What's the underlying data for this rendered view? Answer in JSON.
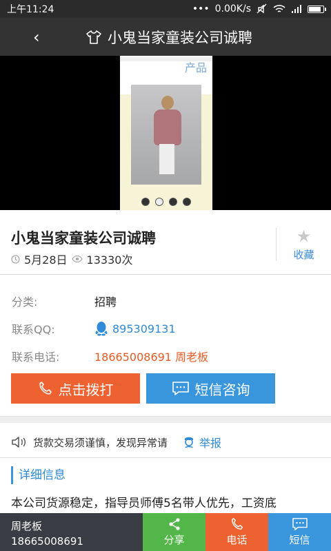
{
  "status_bar": {
    "time": "上午11:24",
    "dots": "•••",
    "network_speed": "0.00K/s",
    "battery_level": 0.9
  },
  "header": {
    "back_symbol": "‹",
    "title": "小鬼当家童装公司诚聘",
    "icon": "shirt-icon"
  },
  "carousel": {
    "poster_title": "产品",
    "slide_count": 4,
    "active_index": 1
  },
  "listing": {
    "title": "小鬼当家童装公司诚聘",
    "date": "5月28日",
    "views": "13330次",
    "favorite_label": "收藏"
  },
  "details": {
    "category_label": "分类:",
    "category_value": "招聘",
    "qq_label": "联系QQ:",
    "qq_value": "895309131",
    "phone_label": "联系电话:",
    "phone_value": "18665008691 周老板"
  },
  "actions": {
    "call_label": "点击拨打",
    "sms_label": "短信咨询"
  },
  "notice": {
    "text": "货款交易须谨慎，发现异常请",
    "report_label": "举报"
  },
  "section": {
    "title": "详细信息",
    "description": "本公司货源稳定，指导员师傅5名带人优先，工资底"
  },
  "bottom_bar": {
    "contact_name": "周老板",
    "contact_phone": "18665008691",
    "share_label": "分享",
    "call_label": "电话",
    "sms_label": "短信"
  },
  "colors": {
    "accent_blue": "#3a96dc",
    "accent_orange": "#ee6130",
    "accent_green": "#53b649",
    "header_bg": "#333333"
  }
}
